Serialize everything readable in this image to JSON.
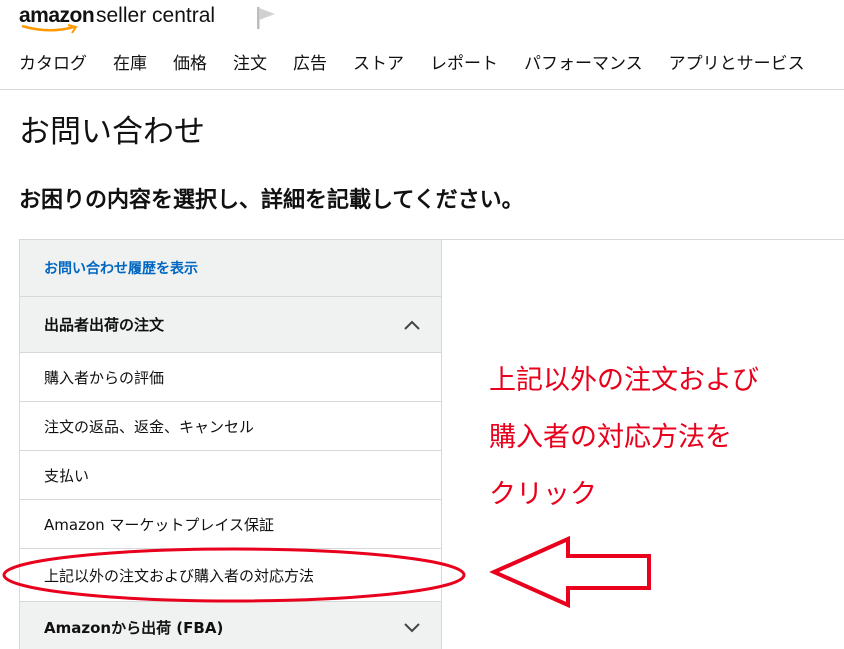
{
  "header": {
    "logo_amazon": "amazon",
    "logo_product": "seller central",
    "nav": [
      "カタログ",
      "在庫",
      "価格",
      "注文",
      "広告",
      "ストア",
      "レポート",
      "パフォーマンス",
      "アプリとサービス"
    ]
  },
  "page": {
    "title": "お問い合わせ",
    "subtitle": "お困りの内容を選択し、詳細を記載してください。"
  },
  "panel": {
    "history_link": "お問い合わせ履歴を表示",
    "section_title": "出品者出荷の注文",
    "items": [
      "購入者からの評価",
      "注文の返品、返金、キャンセル",
      "支払い",
      "Amazon マーケットプレイス保証",
      "上記以外の注文および購入者の対応方法"
    ],
    "next_section_title": "Amazonから出荷 (FBA)"
  },
  "annotation": {
    "lines": [
      "上記以外の注文および",
      "購入者の対応方法を",
      "クリック"
    ],
    "color": "#e8001c"
  },
  "icons": {
    "flag": "flag-icon",
    "section_expanded": "chevron-up-icon",
    "section_collapsed": "chevron-down-icon",
    "callout": "arrow-left-outline",
    "highlight": "red-ellipse"
  }
}
